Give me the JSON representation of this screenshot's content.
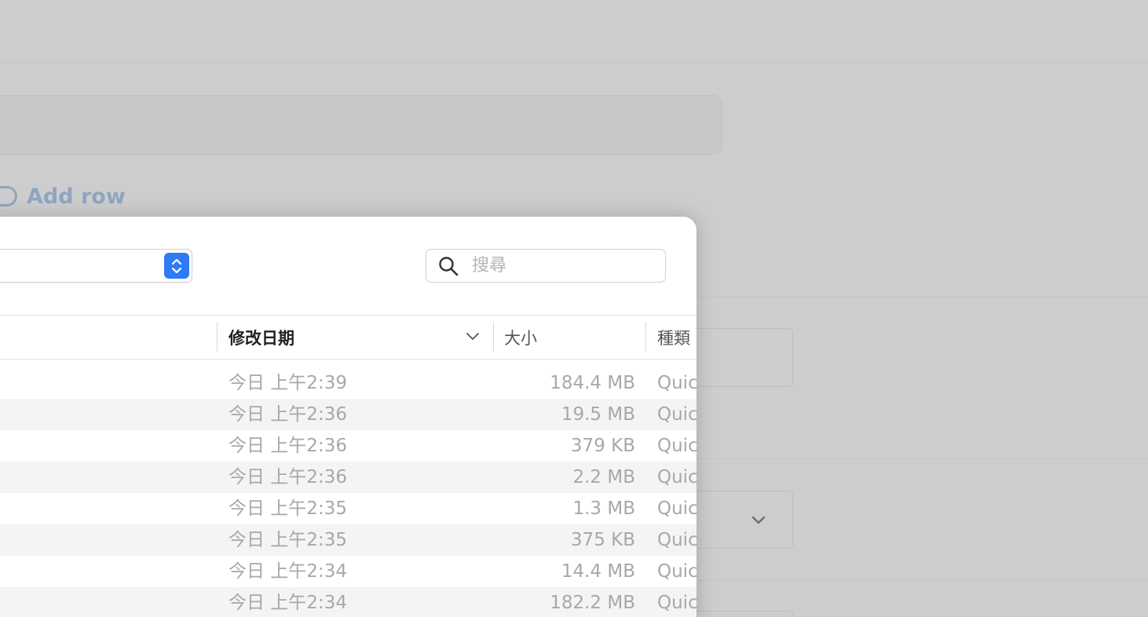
{
  "background": {
    "add_row_label": "Add row"
  },
  "dialog": {
    "search": {
      "placeholder": "搜尋"
    },
    "columns": {
      "date_modified": "修改日期",
      "size": "大小",
      "kind": "種類"
    },
    "sort_icon": "chevron-down-icon",
    "rows": [
      {
        "date": "今日 上午2:39",
        "size": "184.4 MB",
        "kind": "Quic"
      },
      {
        "date": "今日 上午2:36",
        "size": "19.5 MB",
        "kind": "Quic"
      },
      {
        "date": "今日 上午2:36",
        "size": "379 KB",
        "kind": "Quic"
      },
      {
        "date": "今日 上午2:36",
        "size": "2.2 MB",
        "kind": "Quic"
      },
      {
        "date": "今日 上午2:35",
        "size": "1.3 MB",
        "kind": "Quic"
      },
      {
        "date": "今日 上午2:35",
        "size": "375 KB",
        "kind": "Quic"
      },
      {
        "date": "今日 上午2:34",
        "size": "14.4 MB",
        "kind": "Quic"
      },
      {
        "date": "今日 上午2:34",
        "size": "182.2 MB",
        "kind": "Quic"
      }
    ]
  },
  "colors": {
    "accent": "#2f7bf6",
    "link": "#8fa5bf",
    "row_alt": "#f3f4f4"
  }
}
